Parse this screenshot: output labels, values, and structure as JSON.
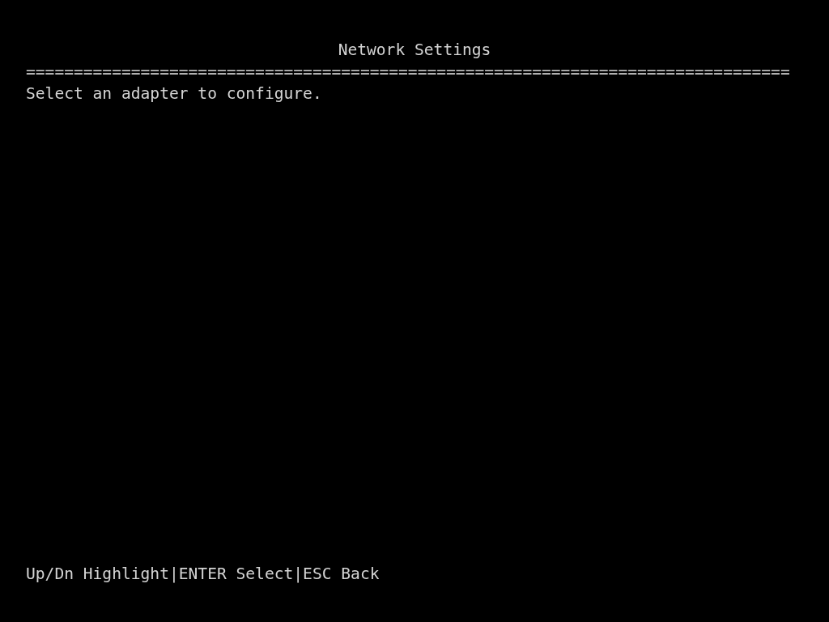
{
  "title": "Network Settings",
  "separator": "================================================================================",
  "prompt": "Select an adapter to configure.",
  "footer": "Up/Dn Highlight|ENTER Select|ESC Back"
}
